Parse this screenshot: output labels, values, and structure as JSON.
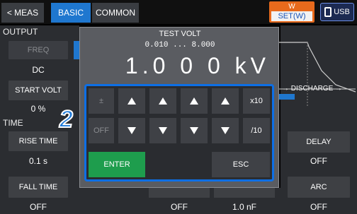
{
  "tabs": {
    "meas": "< MEAS",
    "basic": "BASIC",
    "common": "COMMON"
  },
  "wset": {
    "top": "W",
    "bottom": "SET(W)"
  },
  "usb": "USB",
  "left": {
    "output_label": "OUTPUT",
    "freq_button": "FREQ",
    "freq_value": "DC",
    "start_volt_button": "START VOLT",
    "start_volt_value": "0 %",
    "time_label": "TIME",
    "rise_time_button": "RISE TIME",
    "rise_time_value": "0.1 s",
    "fall_time_button": "FALL TIME",
    "fall_time_value": "OFF"
  },
  "right": {
    "discharge_label": "DISCHARGE",
    "delay_button": "DELAY",
    "delay_value": "OFF",
    "arc_button": "ARC",
    "arc_value": "OFF",
    "bottom_mid_value1": "OFF",
    "bottom_mid_value2": "1.0 nF"
  },
  "dialog": {
    "title": "TEST VOLT",
    "range": "0.010 ... 8.000",
    "value": "1.0 0 0 kV",
    "keys": {
      "plusminus": "±",
      "off": "OFF",
      "x10": "x10",
      "div10": "/10",
      "enter": "ENTER",
      "esc": "ESC"
    }
  },
  "badge": "2"
}
